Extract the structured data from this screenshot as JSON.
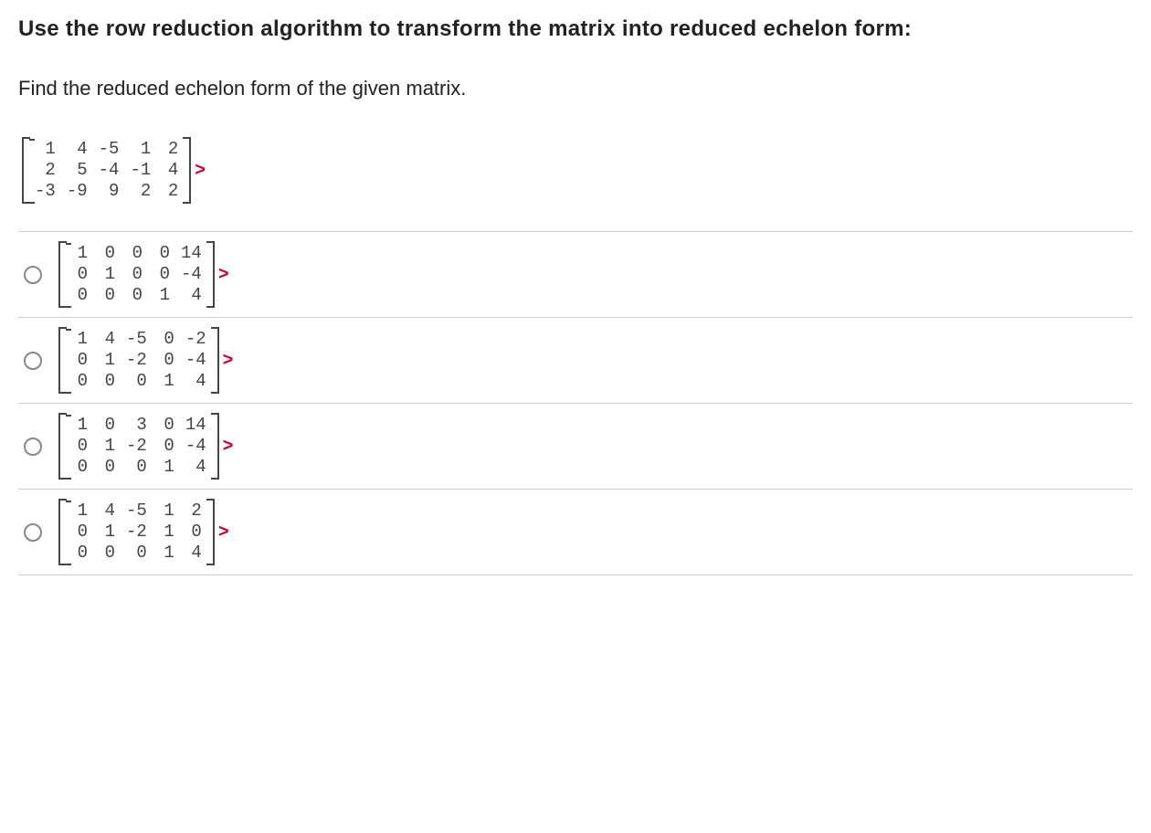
{
  "title": "Use the row reduction algorithm to transform the matrix into reduced echelon form:",
  "prompt": "Find the reduced echelon form of the given matrix.",
  "given_matrix": [
    [
      "1",
      "4",
      "-5",
      "1",
      "2"
    ],
    [
      "2",
      "5",
      "-4",
      "-1",
      "4"
    ],
    [
      "-3",
      "-9",
      "9",
      "2",
      "2"
    ]
  ],
  "options": [
    {
      "rows": [
        [
          "1",
          "0",
          "0",
          "0",
          "14"
        ],
        [
          "0",
          "1",
          "0",
          "0",
          "-4"
        ],
        [
          "0",
          "0",
          "0",
          "1",
          "4"
        ]
      ]
    },
    {
      "rows": [
        [
          "1",
          "4",
          "-5",
          "0",
          "-2"
        ],
        [
          "0",
          "1",
          "-2",
          "0",
          "-4"
        ],
        [
          "0",
          "0",
          "0",
          "1",
          "4"
        ]
      ]
    },
    {
      "rows": [
        [
          "1",
          "0",
          "3",
          "0",
          "14"
        ],
        [
          "0",
          "1",
          "-2",
          "0",
          "-4"
        ],
        [
          "0",
          "0",
          "0",
          "1",
          "4"
        ]
      ]
    },
    {
      "rows": [
        [
          "1",
          "4",
          "-5",
          "1",
          "2"
        ],
        [
          "0",
          "1",
          "-2",
          "1",
          "0"
        ],
        [
          "0",
          "0",
          "0",
          "1",
          "4"
        ]
      ]
    }
  ],
  "gt_symbol": ">"
}
